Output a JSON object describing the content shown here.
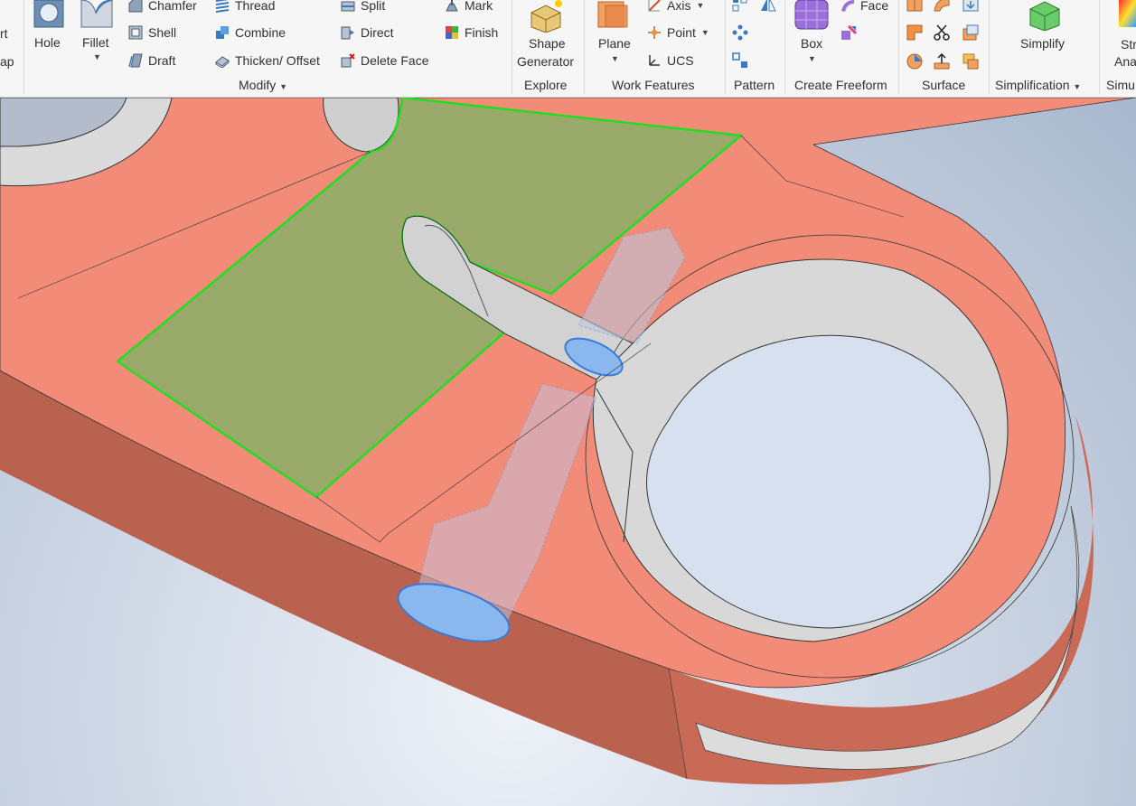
{
  "ribbon": {
    "partial_left": {
      "top": "rt",
      "bottom": "ap"
    },
    "modify": {
      "hole": "Hole",
      "fillet": "Fillet",
      "chamfer": "Chamfer",
      "shell": "Shell",
      "draft": "Draft",
      "thread": "Thread",
      "combine": "Combine",
      "thicken_offset": "Thicken/ Offset",
      "split": "Split",
      "direct": "Direct",
      "delete_face": "Delete Face",
      "mark": "Mark",
      "finish": "Finish",
      "group_label": "Modify"
    },
    "explore": {
      "shape_generator_line1": "Shape",
      "shape_generator_line2": "Generator",
      "group_label": "Explore"
    },
    "work_features": {
      "plane": "Plane",
      "axis": "Axis",
      "point": "Point",
      "ucs": "UCS",
      "group_label": "Work Features"
    },
    "pattern": {
      "group_label": "Pattern"
    },
    "create_freeform": {
      "box": "Box",
      "face": "Face",
      "group_label": "Create Freeform"
    },
    "surface": {
      "group_label": "Surface"
    },
    "simplification": {
      "simplify": "Simplify",
      "group_label": "Simplification"
    },
    "simulation": {
      "partial_line1": "Str",
      "partial_line2": "Ana",
      "partial_group": "Simu"
    }
  },
  "colors": {
    "part_face": "#f28c78",
    "part_side": "#c86a57",
    "selected_face": "#9aaa6a",
    "selection_edge": "#22dd22",
    "hole_interior": "#d4d4d4",
    "ghost_bolt": "#a8c8ec",
    "viewport_bg": "#c9d3e2"
  }
}
